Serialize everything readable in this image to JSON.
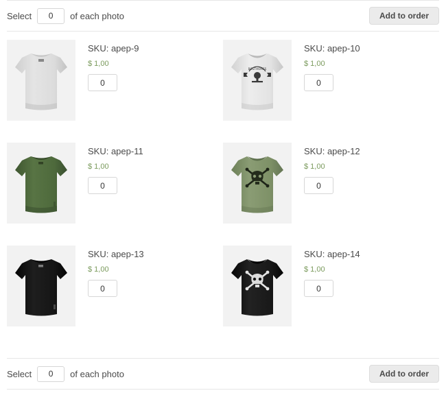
{
  "bulk_bar_top": {
    "prefix_label": "Select",
    "quantity_value": "0",
    "suffix_label": "of each photo",
    "button_label": "Add to order"
  },
  "bulk_bar_bottom": {
    "prefix_label": "Select",
    "quantity_value": "0",
    "suffix_label": "of each photo",
    "button_label": "Add to order"
  },
  "colors": {
    "price_green": "#7a9a5c",
    "button_face": "#ebebeb",
    "photo_background": "#f2f2f2",
    "rule": "#e6e6e6",
    "text": "#4a4a4a"
  },
  "products": [
    {
      "sku": "SKU: apep-9",
      "price": "$ 1,00",
      "quantity_value": "0",
      "image_name": "tshirt-white-back-photo",
      "shirt_color": "#d9d9d9",
      "shirt_shade": "#c4c4c4",
      "view": "back",
      "graphic": "none"
    },
    {
      "sku": "SKU: apep-10",
      "price": "$ 1,00",
      "quantity_value": "0",
      "image_name": "tshirt-white-front-emblem-photo",
      "shirt_color": "#e2e2e2",
      "shirt_shade": "#cfcfcf",
      "view": "front",
      "graphic": "emblem-dark"
    },
    {
      "sku": "SKU: apep-11",
      "price": "$ 1,00",
      "quantity_value": "0",
      "image_name": "tshirt-green-back-photo",
      "shirt_color": "#53703f",
      "shirt_shade": "#445c34",
      "view": "back",
      "graphic": "none"
    },
    {
      "sku": "SKU: apep-12",
      "price": "$ 1,00",
      "quantity_value": "0",
      "image_name": "tshirt-green-front-skull-photo",
      "shirt_color": "#7d9166",
      "shirt_shade": "#68795340",
      "view": "front",
      "graphic": "skull-dark"
    },
    {
      "sku": "SKU: apep-13",
      "price": "$ 1,00",
      "quantity_value": "0",
      "image_name": "tshirt-black-back-photo",
      "shirt_color": "#141414",
      "shirt_shade": "#000000",
      "view": "back",
      "graphic": "none"
    },
    {
      "sku": "SKU: apep-14",
      "price": "$ 1,00",
      "quantity_value": "0",
      "image_name": "tshirt-black-front-skull-photo",
      "shirt_color": "#191919",
      "shirt_shade": "#070707",
      "view": "front",
      "graphic": "skull-light"
    }
  ]
}
